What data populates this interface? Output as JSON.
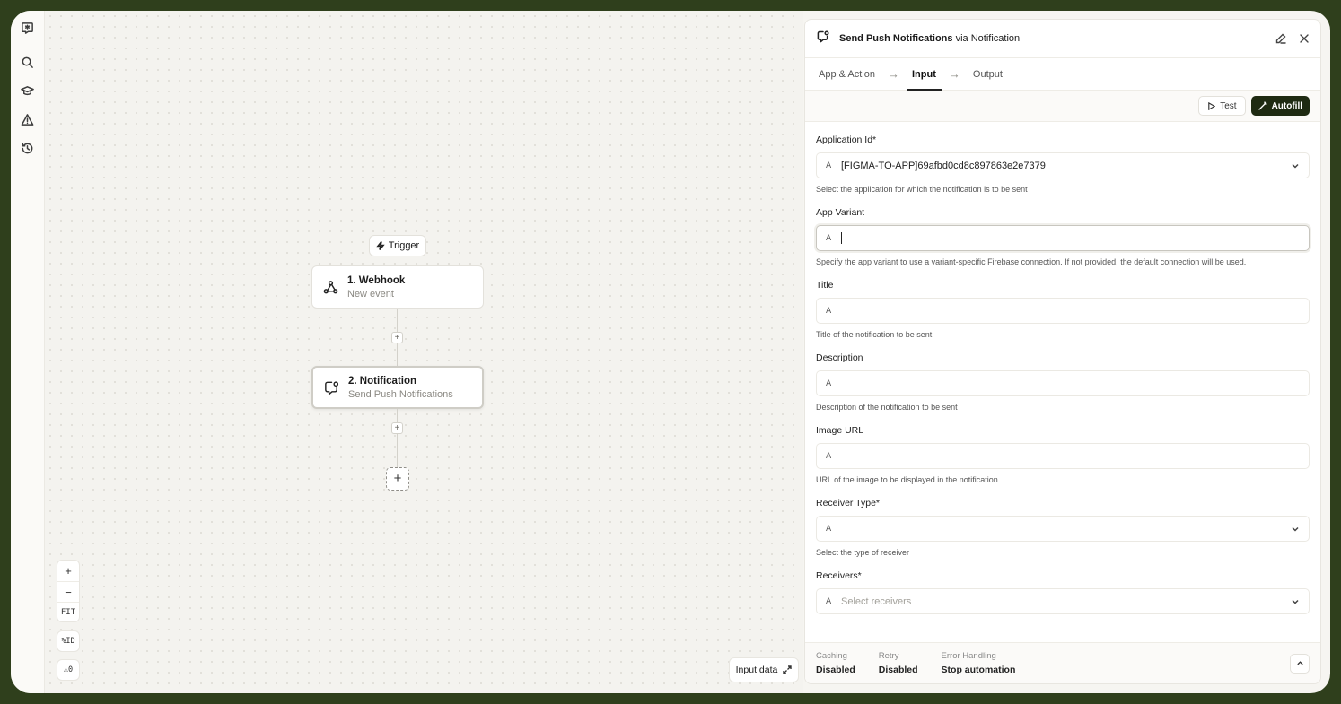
{
  "rail": {
    "items": [
      {
        "name": "logo-icon"
      },
      {
        "name": "search-icon"
      },
      {
        "name": "graduation-cap-icon"
      },
      {
        "name": "warning-icon"
      },
      {
        "name": "history-icon"
      }
    ]
  },
  "canvas": {
    "trigger_label": "Trigger",
    "nodes": [
      {
        "title": "1. Webhook",
        "subtitle": "New event",
        "icon": "webhook-icon"
      },
      {
        "title": "2. Notification",
        "subtitle": "Send Push Notifications",
        "icon": "notification-icon"
      }
    ],
    "add_step": "+",
    "insert": "+",
    "zoom": {
      "zoom_in": "+",
      "zoom_out": "−",
      "fit": "FIT"
    },
    "id_toggle": "%ID",
    "warnings": "⚠0",
    "input_data_label": "Input data"
  },
  "panel": {
    "title_bold": "Send Push Notifications",
    "title_via": " via ",
    "title_app": "Notification",
    "tabs": [
      {
        "label": "App & Action",
        "active": false
      },
      {
        "label": "Input",
        "active": true
      },
      {
        "label": "Output",
        "active": false
      }
    ],
    "tab_separator": "→",
    "test_label": "Test",
    "autofill_label": "Autofill",
    "fields": [
      {
        "label": "Application Id*",
        "type_glyph": "A",
        "value": "[FIGMA-TO-APP]69afbd0cd8c897863e2e7379",
        "placeholder": "",
        "help": "Select the application for which the notification is to be sent",
        "dropdown": true
      },
      {
        "label": "App Variant",
        "type_glyph": "A",
        "value": "",
        "placeholder": "",
        "help": "Specify the app variant to use a variant-specific Firebase connection. If not provided, the default connection will be used.",
        "dropdown": false,
        "focused": true
      },
      {
        "label": "Title",
        "type_glyph": "A",
        "value": "",
        "placeholder": "",
        "help": "Title of the notification to be sent",
        "dropdown": false
      },
      {
        "label": "Description",
        "type_glyph": "A",
        "value": "",
        "placeholder": "",
        "help": "Description of the notification to be sent",
        "dropdown": false
      },
      {
        "label": "Image URL",
        "type_glyph": "A",
        "value": "",
        "placeholder": "",
        "help": "URL of the image to be displayed in the notification",
        "dropdown": false
      },
      {
        "label": "Receiver Type*",
        "type_glyph": "A",
        "value": "",
        "placeholder": "",
        "help": "Select the type of receiver",
        "dropdown": true
      },
      {
        "label": "Receivers*",
        "type_glyph": "A",
        "value": "",
        "placeholder": "Select receivers",
        "help": "",
        "dropdown": true
      }
    ],
    "footer": [
      {
        "key": "Caching",
        "value": "Disabled"
      },
      {
        "key": "Retry",
        "value": "Disabled"
      },
      {
        "key": "Error Handling",
        "value": "Stop automation"
      }
    ]
  }
}
